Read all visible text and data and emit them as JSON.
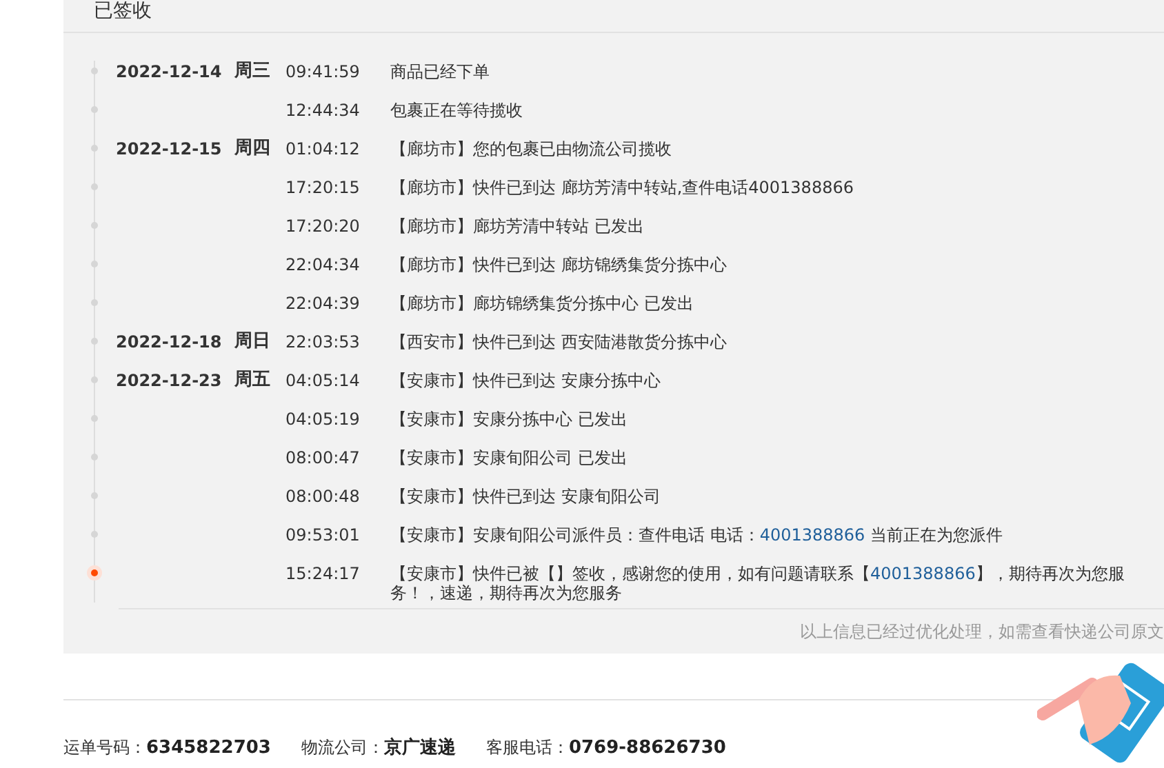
{
  "status_title": "已签收",
  "days": [
    {
      "date": "2022-12-14",
      "weekday": "周三",
      "events": [
        {
          "time": "09:41:59",
          "latest": false,
          "parts": [
            {
              "kind": "plain",
              "text": "商品已经下单"
            }
          ]
        },
        {
          "time": "12:44:34",
          "latest": false,
          "parts": [
            {
              "kind": "plain",
              "text": "包裹正在等待揽收"
            }
          ]
        }
      ]
    },
    {
      "date": "2022-12-15",
      "weekday": "周四",
      "events": [
        {
          "time": "01:04:12",
          "latest": false,
          "parts": [
            {
              "kind": "plain",
              "text": "【廊坊市】您的包裹已由物流公司揽收"
            }
          ]
        },
        {
          "time": "17:20:15",
          "latest": false,
          "parts": [
            {
              "kind": "plain",
              "text": "【廊坊市】快件已到达 廊坊芳清中转站,查件电话4001388866"
            }
          ]
        },
        {
          "time": "17:20:20",
          "latest": false,
          "parts": [
            {
              "kind": "plain",
              "text": "【廊坊市】廊坊芳清中转站 已发出"
            }
          ]
        },
        {
          "time": "22:04:34",
          "latest": false,
          "parts": [
            {
              "kind": "plain",
              "text": "【廊坊市】快件已到达 廊坊锦绣集货分拣中心"
            }
          ]
        },
        {
          "time": "22:04:39",
          "latest": false,
          "parts": [
            {
              "kind": "plain",
              "text": "【廊坊市】廊坊锦绣集货分拣中心 已发出"
            }
          ]
        }
      ]
    },
    {
      "date": "2022-12-18",
      "weekday": "周日",
      "events": [
        {
          "time": "22:03:53",
          "latest": false,
          "parts": [
            {
              "kind": "plain",
              "text": "【西安市】快件已到达 西安陆港散货分拣中心"
            }
          ]
        }
      ]
    },
    {
      "date": "2022-12-23",
      "weekday": "周五",
      "events": [
        {
          "time": "04:05:14",
          "latest": false,
          "parts": [
            {
              "kind": "plain",
              "text": "【安康市】快件已到达 安康分拣中心"
            }
          ]
        },
        {
          "time": "04:05:19",
          "latest": false,
          "parts": [
            {
              "kind": "plain",
              "text": "【安康市】安康分拣中心 已发出"
            }
          ]
        },
        {
          "time": "08:00:47",
          "latest": false,
          "parts": [
            {
              "kind": "plain",
              "text": "【安康市】安康旬阳公司 已发出"
            }
          ]
        },
        {
          "time": "08:00:48",
          "latest": false,
          "parts": [
            {
              "kind": "plain",
              "text": "【安康市】快件已到达 安康旬阳公司"
            }
          ]
        },
        {
          "time": "09:53:01",
          "latest": false,
          "parts": [
            {
              "kind": "plain",
              "text": "【安康市】安康旬阳公司派件员：查件电话 电话："
            },
            {
              "kind": "phone",
              "text": "4001388866"
            },
            {
              "kind": "plain",
              "text": " 当前正在为您派件"
            }
          ]
        },
        {
          "time": "15:24:17",
          "latest": true,
          "parts": [
            {
              "kind": "plain",
              "text": "【安康市】快件已被【】签收，感谢您的使用，如有问题请联系【"
            },
            {
              "kind": "phone",
              "text": "4001388866"
            },
            {
              "kind": "plain",
              "text": "】，期待再次为您服务！，速递，期待再次为您服务"
            }
          ]
        }
      ]
    }
  ],
  "note": "以上信息已经过优化处理，如需查看快递公司原文",
  "info": [
    {
      "label": "运单号码：",
      "value": "6345822703"
    },
    {
      "label": "物流公司：",
      "value": "京广速递"
    },
    {
      "label": "客服电话：",
      "value": "0769-88626730"
    }
  ]
}
